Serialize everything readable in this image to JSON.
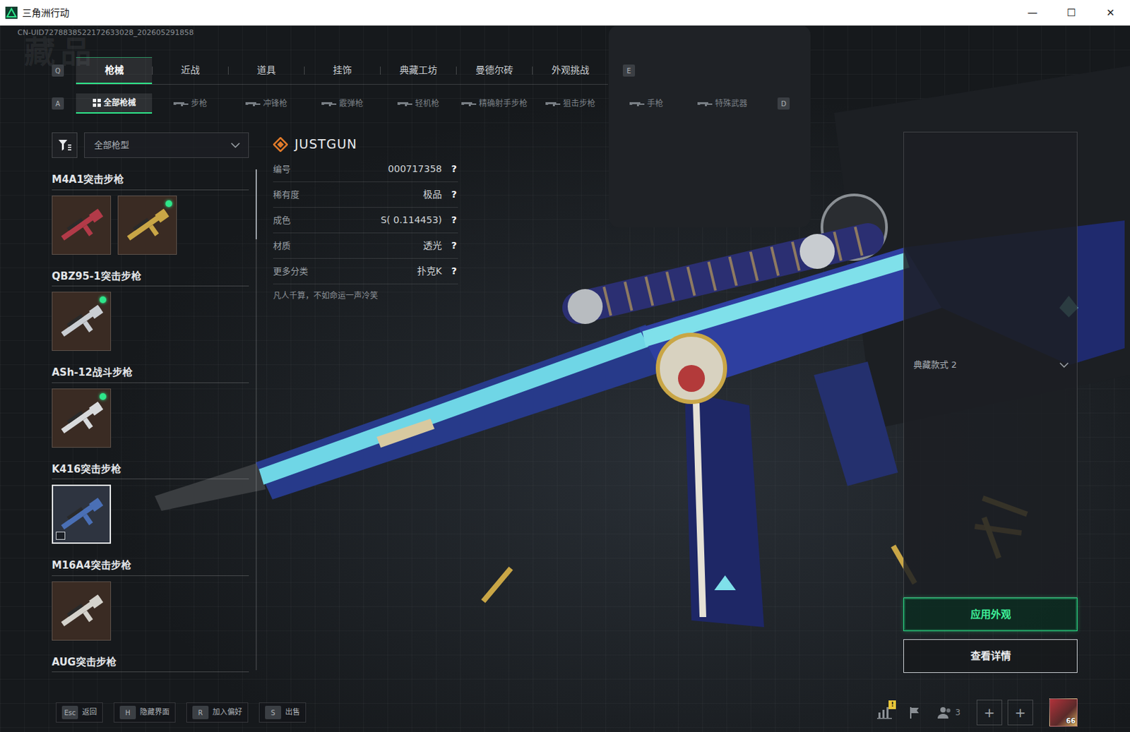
{
  "window": {
    "title": "三角洲行动",
    "controls": [
      "—",
      "☐",
      "✕"
    ]
  },
  "uid": "CN-UID7278838522172633028_202605291858",
  "watermark": "藏品",
  "main_tabs": {
    "prev_key": "Q",
    "next_key": "E",
    "items": [
      {
        "label": "枪械",
        "selected": true
      },
      {
        "label": "近战",
        "selected": false
      },
      {
        "label": "道具",
        "selected": false
      },
      {
        "label": "挂饰",
        "selected": false
      },
      {
        "label": "典藏工坊",
        "selected": false
      },
      {
        "label": "曼德尔砖",
        "selected": false
      },
      {
        "label": "外观挑战",
        "selected": false
      }
    ]
  },
  "sub_tabs": {
    "prev_key": "A",
    "next_key": "D",
    "items": [
      {
        "label": "全部枪械",
        "selected": true,
        "kind": "all"
      },
      {
        "label": "步枪",
        "selected": false,
        "kind": "weapon"
      },
      {
        "label": "冲锋枪",
        "selected": false,
        "kind": "weapon"
      },
      {
        "label": "霰弹枪",
        "selected": false,
        "kind": "weapon"
      },
      {
        "label": "轻机枪",
        "selected": false,
        "kind": "weapon"
      },
      {
        "label": "精确射手步枪",
        "selected": false,
        "kind": "weapon"
      },
      {
        "label": "狙击步枪",
        "selected": false,
        "kind": "weapon"
      },
      {
        "label": "手枪",
        "selected": false,
        "kind": "weapon"
      },
      {
        "label": "特殊武器",
        "selected": false,
        "kind": "weapon"
      }
    ]
  },
  "filter": {
    "value": "全部枪型"
  },
  "weapons": [
    {
      "name": "M4A1突击步枪",
      "skins": [
        {
          "selected": false,
          "equipped": false,
          "tagged": false,
          "color": "#b23a48"
        },
        {
          "selected": false,
          "equipped": true,
          "tagged": false,
          "color": "#c9a646"
        }
      ]
    },
    {
      "name": "QBZ95-1突击步枪",
      "skins": [
        {
          "selected": false,
          "equipped": true,
          "tagged": false,
          "color": "#c9cdd2"
        }
      ]
    },
    {
      "name": "ASh-12战斗步枪",
      "skins": [
        {
          "selected": false,
          "equipped": true,
          "tagged": false,
          "color": "#d8dadc"
        }
      ]
    },
    {
      "name": "K416突击步枪",
      "skins": [
        {
          "selected": true,
          "equipped": false,
          "tagged": true,
          "color": "#4a6fb5"
        }
      ]
    },
    {
      "name": "M16A4突击步枪",
      "skins": [
        {
          "selected": false,
          "equipped": false,
          "tagged": false,
          "color": "#d4d2cc"
        }
      ]
    },
    {
      "name": "AUG突击步枪",
      "skins": []
    }
  ],
  "scroll": {
    "level": 0.14
  },
  "item": {
    "name": "JUSTGUN",
    "fields": [
      {
        "label": "编号",
        "value": "000717358",
        "help": "?"
      },
      {
        "label": "稀有度",
        "value": "极品",
        "help": "?"
      },
      {
        "label": "成色",
        "value": "S( 0.114453)",
        "help": "?"
      },
      {
        "label": "材质",
        "value": "透光",
        "help": "?"
      },
      {
        "label": "更多分类",
        "value": "扑克K",
        "help": "?"
      }
    ],
    "quote": "凡人千算，不如命运一声冷笑"
  },
  "style_select": {
    "value": "典藏款式 2"
  },
  "buttons": [
    {
      "label": "应用外观",
      "primary": true
    },
    {
      "label": "查看详情",
      "primary": false
    }
  ],
  "key_hints": [
    {
      "key": "Esc",
      "label": "返回"
    },
    {
      "key": "H",
      "label": "隐藏界面"
    },
    {
      "key": "R",
      "label": "加入偏好"
    },
    {
      "key": "S",
      "label": "出售"
    }
  ],
  "tray": {
    "alert": "!",
    "friends": "3",
    "slots": [
      "+",
      "+"
    ],
    "avatar_level": "66"
  }
}
